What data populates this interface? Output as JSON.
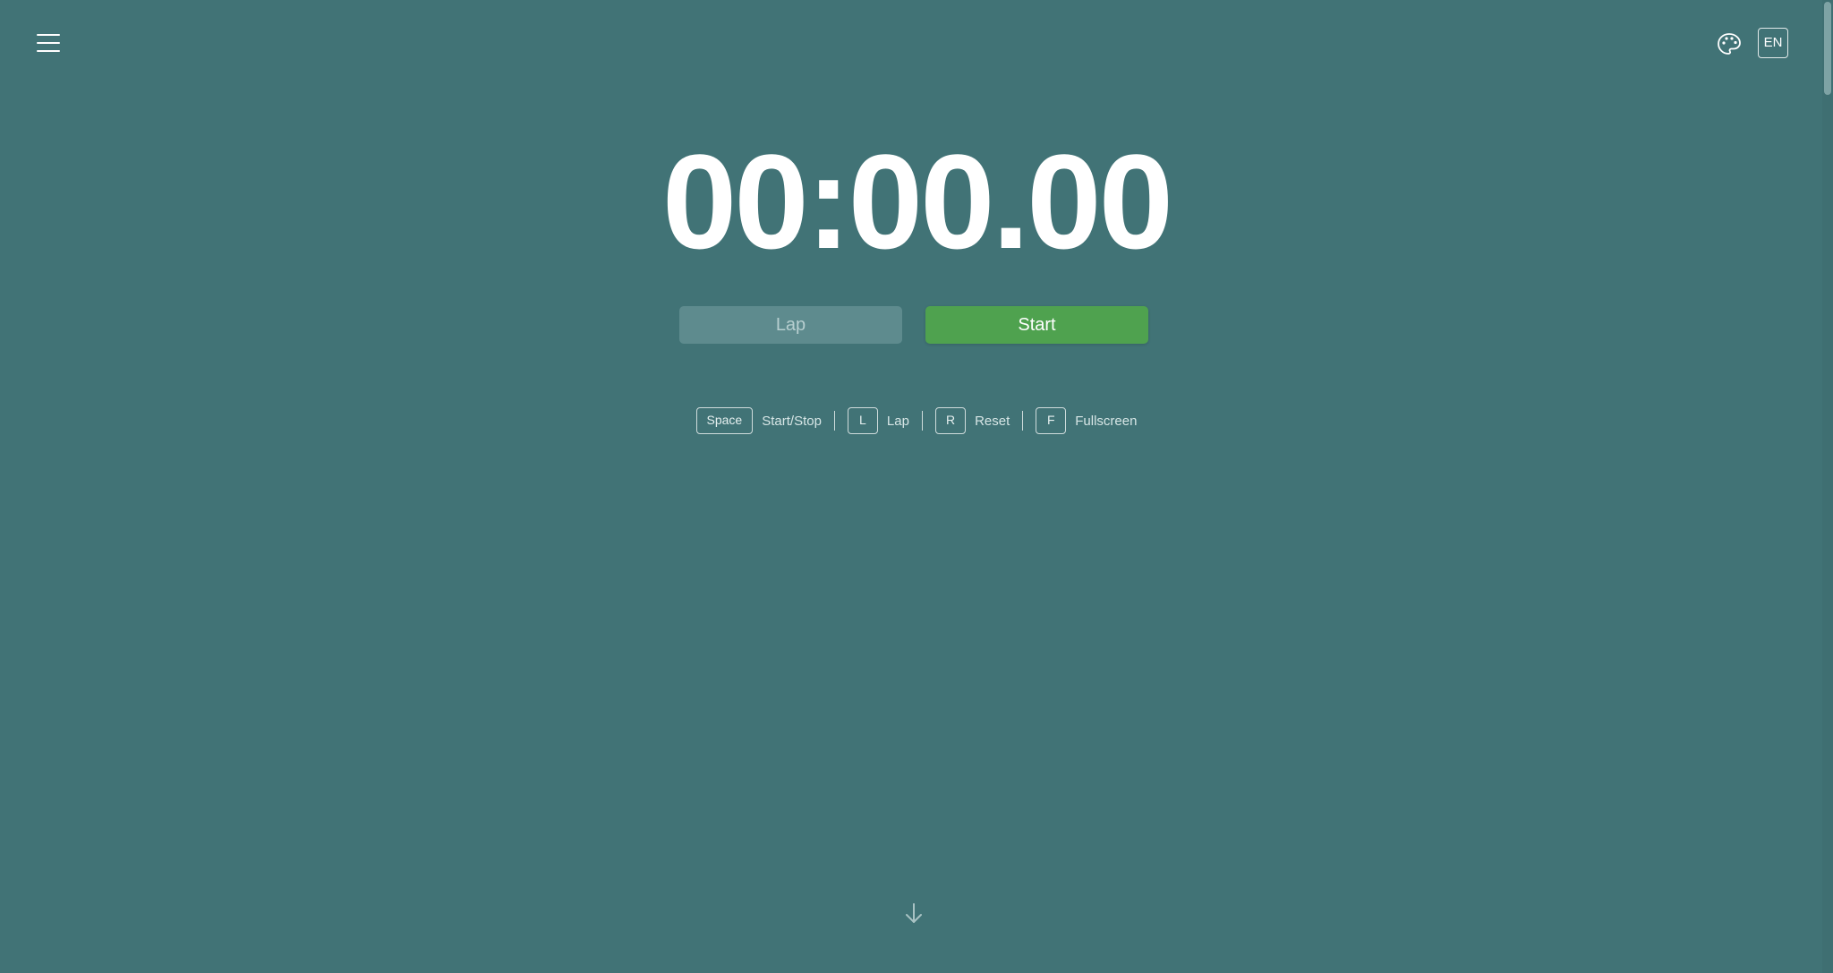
{
  "header": {
    "menu_icon": "hamburger-menu-icon",
    "theme_icon": "palette-icon",
    "language_label": "EN"
  },
  "timer": {
    "display": "00:00.00"
  },
  "controls": {
    "lap_label": "Lap",
    "start_label": "Start"
  },
  "shortcuts": [
    {
      "key": "Space",
      "label": "Start/Stop"
    },
    {
      "key": "L",
      "label": "Lap"
    },
    {
      "key": "R",
      "label": "Reset"
    },
    {
      "key": "F",
      "label": "Fullscreen"
    }
  ],
  "footer": {
    "scroll_icon": "arrow-down-icon"
  },
  "colors": {
    "background": "#417376",
    "start_button": "#4fa24f",
    "lap_button": "#5e8b8e",
    "text": "#ffffff"
  }
}
